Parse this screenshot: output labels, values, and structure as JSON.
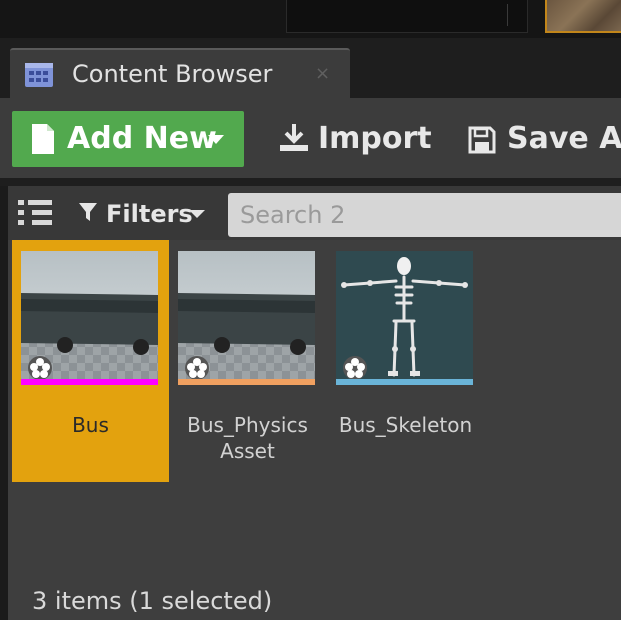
{
  "tab": {
    "title": "Content Browser",
    "close": "×"
  },
  "toolbar": {
    "add_new": "Add New",
    "import": "Import",
    "save_all": "Save All"
  },
  "filters": {
    "label": "Filters",
    "search_placeholder": "Search 2"
  },
  "assets": [
    {
      "name": "Bus",
      "selected": true,
      "type_color": "#ff00ff",
      "thumbnail": "bus-mesh"
    },
    {
      "name": "Bus_Physics\nAsset",
      "selected": false,
      "type_color": "#f0a060",
      "thumbnail": "bus-mesh"
    },
    {
      "name": "Bus_Skeleton",
      "selected": false,
      "type_color": "#6ab4d8",
      "thumbnail": "skeleton"
    }
  ],
  "status": "3 items (1 selected)",
  "colors": {
    "accent_green": "#52a94e",
    "selection": "#e3a20e",
    "panel": "#3e3e3e"
  },
  "icons": [
    "content-browser-icon",
    "document-icon",
    "import-icon",
    "save-icon",
    "funnel-icon",
    "view-toggle-icon",
    "asset-star-icon"
  ]
}
